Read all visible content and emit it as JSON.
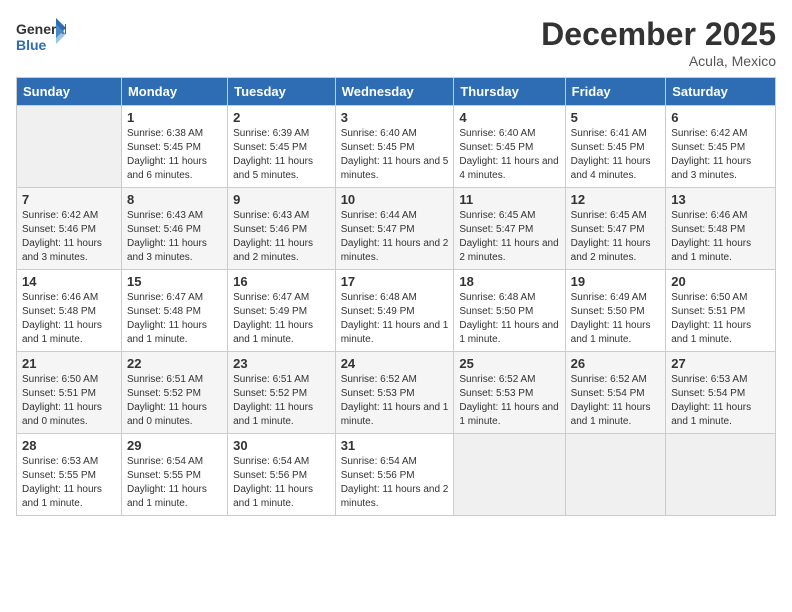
{
  "header": {
    "logo_general": "General",
    "logo_blue": "Blue",
    "title": "December 2025",
    "subtitle": "Acula, Mexico"
  },
  "days_of_week": [
    "Sunday",
    "Monday",
    "Tuesday",
    "Wednesday",
    "Thursday",
    "Friday",
    "Saturday"
  ],
  "weeks": [
    [
      {
        "day": "",
        "sunrise": "",
        "sunset": "",
        "daylight": ""
      },
      {
        "day": "1",
        "sunrise": "Sunrise: 6:38 AM",
        "sunset": "Sunset: 5:45 PM",
        "daylight": "Daylight: 11 hours and 6 minutes."
      },
      {
        "day": "2",
        "sunrise": "Sunrise: 6:39 AM",
        "sunset": "Sunset: 5:45 PM",
        "daylight": "Daylight: 11 hours and 5 minutes."
      },
      {
        "day": "3",
        "sunrise": "Sunrise: 6:40 AM",
        "sunset": "Sunset: 5:45 PM",
        "daylight": "Daylight: 11 hours and 5 minutes."
      },
      {
        "day": "4",
        "sunrise": "Sunrise: 6:40 AM",
        "sunset": "Sunset: 5:45 PM",
        "daylight": "Daylight: 11 hours and 4 minutes."
      },
      {
        "day": "5",
        "sunrise": "Sunrise: 6:41 AM",
        "sunset": "Sunset: 5:45 PM",
        "daylight": "Daylight: 11 hours and 4 minutes."
      },
      {
        "day": "6",
        "sunrise": "Sunrise: 6:42 AM",
        "sunset": "Sunset: 5:45 PM",
        "daylight": "Daylight: 11 hours and 3 minutes."
      }
    ],
    [
      {
        "day": "7",
        "sunrise": "Sunrise: 6:42 AM",
        "sunset": "Sunset: 5:46 PM",
        "daylight": "Daylight: 11 hours and 3 minutes."
      },
      {
        "day": "8",
        "sunrise": "Sunrise: 6:43 AM",
        "sunset": "Sunset: 5:46 PM",
        "daylight": "Daylight: 11 hours and 3 minutes."
      },
      {
        "day": "9",
        "sunrise": "Sunrise: 6:43 AM",
        "sunset": "Sunset: 5:46 PM",
        "daylight": "Daylight: 11 hours and 2 minutes."
      },
      {
        "day": "10",
        "sunrise": "Sunrise: 6:44 AM",
        "sunset": "Sunset: 5:47 PM",
        "daylight": "Daylight: 11 hours and 2 minutes."
      },
      {
        "day": "11",
        "sunrise": "Sunrise: 6:45 AM",
        "sunset": "Sunset: 5:47 PM",
        "daylight": "Daylight: 11 hours and 2 minutes."
      },
      {
        "day": "12",
        "sunrise": "Sunrise: 6:45 AM",
        "sunset": "Sunset: 5:47 PM",
        "daylight": "Daylight: 11 hours and 2 minutes."
      },
      {
        "day": "13",
        "sunrise": "Sunrise: 6:46 AM",
        "sunset": "Sunset: 5:48 PM",
        "daylight": "Daylight: 11 hours and 1 minute."
      }
    ],
    [
      {
        "day": "14",
        "sunrise": "Sunrise: 6:46 AM",
        "sunset": "Sunset: 5:48 PM",
        "daylight": "Daylight: 11 hours and 1 minute."
      },
      {
        "day": "15",
        "sunrise": "Sunrise: 6:47 AM",
        "sunset": "Sunset: 5:48 PM",
        "daylight": "Daylight: 11 hours and 1 minute."
      },
      {
        "day": "16",
        "sunrise": "Sunrise: 6:47 AM",
        "sunset": "Sunset: 5:49 PM",
        "daylight": "Daylight: 11 hours and 1 minute."
      },
      {
        "day": "17",
        "sunrise": "Sunrise: 6:48 AM",
        "sunset": "Sunset: 5:49 PM",
        "daylight": "Daylight: 11 hours and 1 minute."
      },
      {
        "day": "18",
        "sunrise": "Sunrise: 6:48 AM",
        "sunset": "Sunset: 5:50 PM",
        "daylight": "Daylight: 11 hours and 1 minute."
      },
      {
        "day": "19",
        "sunrise": "Sunrise: 6:49 AM",
        "sunset": "Sunset: 5:50 PM",
        "daylight": "Daylight: 11 hours and 1 minute."
      },
      {
        "day": "20",
        "sunrise": "Sunrise: 6:50 AM",
        "sunset": "Sunset: 5:51 PM",
        "daylight": "Daylight: 11 hours and 1 minute."
      }
    ],
    [
      {
        "day": "21",
        "sunrise": "Sunrise: 6:50 AM",
        "sunset": "Sunset: 5:51 PM",
        "daylight": "Daylight: 11 hours and 0 minutes."
      },
      {
        "day": "22",
        "sunrise": "Sunrise: 6:51 AM",
        "sunset": "Sunset: 5:52 PM",
        "daylight": "Daylight: 11 hours and 0 minutes."
      },
      {
        "day": "23",
        "sunrise": "Sunrise: 6:51 AM",
        "sunset": "Sunset: 5:52 PM",
        "daylight": "Daylight: 11 hours and 1 minute."
      },
      {
        "day": "24",
        "sunrise": "Sunrise: 6:52 AM",
        "sunset": "Sunset: 5:53 PM",
        "daylight": "Daylight: 11 hours and 1 minute."
      },
      {
        "day": "25",
        "sunrise": "Sunrise: 6:52 AM",
        "sunset": "Sunset: 5:53 PM",
        "daylight": "Daylight: 11 hours and 1 minute."
      },
      {
        "day": "26",
        "sunrise": "Sunrise: 6:52 AM",
        "sunset": "Sunset: 5:54 PM",
        "daylight": "Daylight: 11 hours and 1 minute."
      },
      {
        "day": "27",
        "sunrise": "Sunrise: 6:53 AM",
        "sunset": "Sunset: 5:54 PM",
        "daylight": "Daylight: 11 hours and 1 minute."
      }
    ],
    [
      {
        "day": "28",
        "sunrise": "Sunrise: 6:53 AM",
        "sunset": "Sunset: 5:55 PM",
        "daylight": "Daylight: 11 hours and 1 minute."
      },
      {
        "day": "29",
        "sunrise": "Sunrise: 6:54 AM",
        "sunset": "Sunset: 5:55 PM",
        "daylight": "Daylight: 11 hours and 1 minute."
      },
      {
        "day": "30",
        "sunrise": "Sunrise: 6:54 AM",
        "sunset": "Sunset: 5:56 PM",
        "daylight": "Daylight: 11 hours and 1 minute."
      },
      {
        "day": "31",
        "sunrise": "Sunrise: 6:54 AM",
        "sunset": "Sunset: 5:56 PM",
        "daylight": "Daylight: 11 hours and 2 minutes."
      },
      {
        "day": "",
        "sunrise": "",
        "sunset": "",
        "daylight": ""
      },
      {
        "day": "",
        "sunrise": "",
        "sunset": "",
        "daylight": ""
      },
      {
        "day": "",
        "sunrise": "",
        "sunset": "",
        "daylight": ""
      }
    ]
  ]
}
